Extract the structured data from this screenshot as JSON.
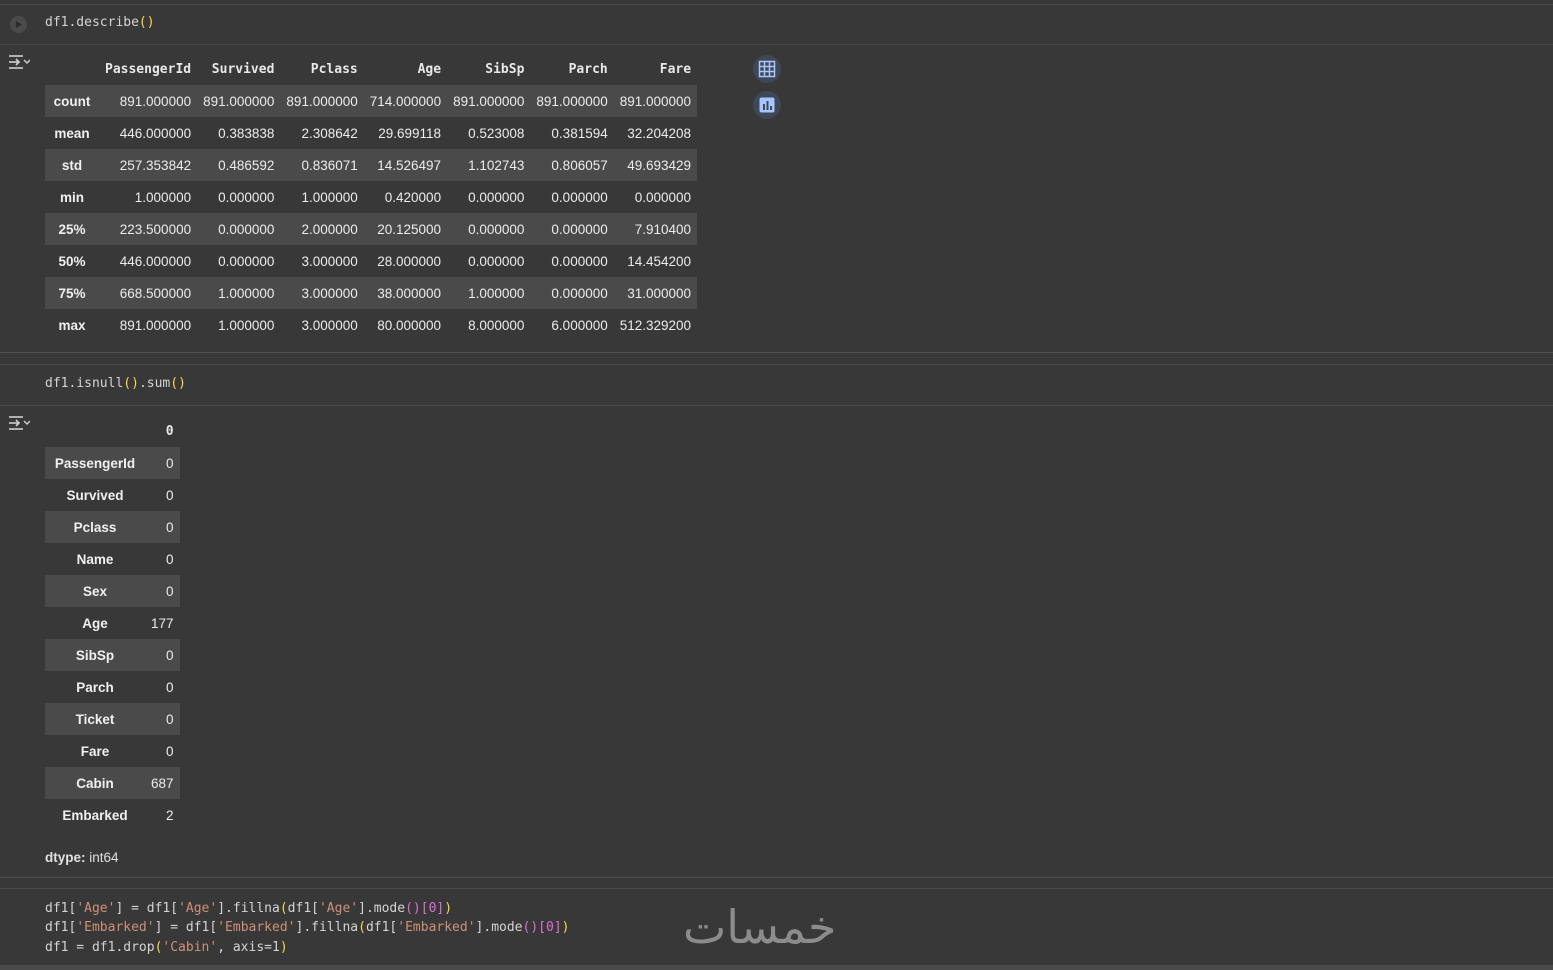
{
  "cells": {
    "describe_code": "df1.describe",
    "describe_paren": "()",
    "isnull_code_a": "df1.isnull",
    "isnull_paren_a": "()",
    "isnull_code_b": ".sum",
    "isnull_paren_b": "()"
  },
  "describe_table": {
    "columns": [
      "PassengerId",
      "Survived",
      "Pclass",
      "Age",
      "SibSp",
      "Parch",
      "Fare"
    ],
    "rows": [
      {
        "label": "count",
        "values": [
          "891.000000",
          "891.000000",
          "891.000000",
          "714.000000",
          "891.000000",
          "891.000000",
          "891.000000"
        ]
      },
      {
        "label": "mean",
        "values": [
          "446.000000",
          "0.383838",
          "2.308642",
          "29.699118",
          "0.523008",
          "0.381594",
          "32.204208"
        ]
      },
      {
        "label": "std",
        "values": [
          "257.353842",
          "0.486592",
          "0.836071",
          "14.526497",
          "1.102743",
          "0.806057",
          "49.693429"
        ]
      },
      {
        "label": "min",
        "values": [
          "1.000000",
          "0.000000",
          "1.000000",
          "0.420000",
          "0.000000",
          "0.000000",
          "0.000000"
        ]
      },
      {
        "label": "25%",
        "values": [
          "223.500000",
          "0.000000",
          "2.000000",
          "20.125000",
          "0.000000",
          "0.000000",
          "7.910400"
        ]
      },
      {
        "label": "50%",
        "values": [
          "446.000000",
          "0.000000",
          "3.000000",
          "28.000000",
          "0.000000",
          "0.000000",
          "14.454200"
        ]
      },
      {
        "label": "75%",
        "values": [
          "668.500000",
          "1.000000",
          "3.000000",
          "38.000000",
          "1.000000",
          "0.000000",
          "31.000000"
        ]
      },
      {
        "label": "max",
        "values": [
          "891.000000",
          "1.000000",
          "3.000000",
          "80.000000",
          "8.000000",
          "6.000000",
          "512.329200"
        ]
      }
    ]
  },
  "isnull_table": {
    "header": "0",
    "rows": [
      {
        "label": "PassengerId",
        "value": "0"
      },
      {
        "label": "Survived",
        "value": "0"
      },
      {
        "label": "Pclass",
        "value": "0"
      },
      {
        "label": "Name",
        "value": "0"
      },
      {
        "label": "Sex",
        "value": "0"
      },
      {
        "label": "Age",
        "value": "177"
      },
      {
        "label": "SibSp",
        "value": "0"
      },
      {
        "label": "Parch",
        "value": "0"
      },
      {
        "label": "Ticket",
        "value": "0"
      },
      {
        "label": "Fare",
        "value": "0"
      },
      {
        "label": "Cabin",
        "value": "687"
      },
      {
        "label": "Embarked",
        "value": "2"
      }
    ],
    "dtype_label": "dtype:",
    "dtype_value": " int64"
  },
  "code_cell_3": {
    "line1": [
      {
        "t": "df1[",
        "c": "plain"
      },
      {
        "t": "'Age'",
        "c": "str"
      },
      {
        "t": "] = df1[",
        "c": "plain"
      },
      {
        "t": "'Age'",
        "c": "str"
      },
      {
        "t": "].fillna",
        "c": "plain"
      },
      {
        "t": "(",
        "c": "paren"
      },
      {
        "t": "df1[",
        "c": "plain"
      },
      {
        "t": "'Age'",
        "c": "str"
      },
      {
        "t": "].mode",
        "c": "plain"
      },
      {
        "t": "()",
        "c": "sq"
      },
      {
        "t": "[0]",
        "c": "sq"
      },
      {
        "t": ")",
        "c": "paren"
      }
    ],
    "line2": [
      {
        "t": "df1[",
        "c": "plain"
      },
      {
        "t": "'Embarked'",
        "c": "str"
      },
      {
        "t": "] = df1[",
        "c": "plain"
      },
      {
        "t": "'Embarked'",
        "c": "str"
      },
      {
        "t": "].fillna",
        "c": "plain"
      },
      {
        "t": "(",
        "c": "paren"
      },
      {
        "t": "df1[",
        "c": "plain"
      },
      {
        "t": "'Embarked'",
        "c": "str"
      },
      {
        "t": "].mode",
        "c": "plain"
      },
      {
        "t": "()",
        "c": "sq"
      },
      {
        "t": "[0]",
        "c": "sq"
      },
      {
        "t": ")",
        "c": "paren"
      }
    ],
    "line3": [
      {
        "t": "df1 = df1.drop",
        "c": "plain"
      },
      {
        "t": "(",
        "c": "paren"
      },
      {
        "t": "'Cabin'",
        "c": "str"
      },
      {
        "t": ", axis=1",
        "c": "plain"
      },
      {
        "t": ")",
        "c": "paren"
      }
    ]
  },
  "watermark": "خمسات",
  "icons": {
    "run": "play-circle-icon",
    "output_toggle": "output-toggle-icon",
    "table_view": "table-grid-icon",
    "chart_suggest": "bar-chart-icon"
  }
}
